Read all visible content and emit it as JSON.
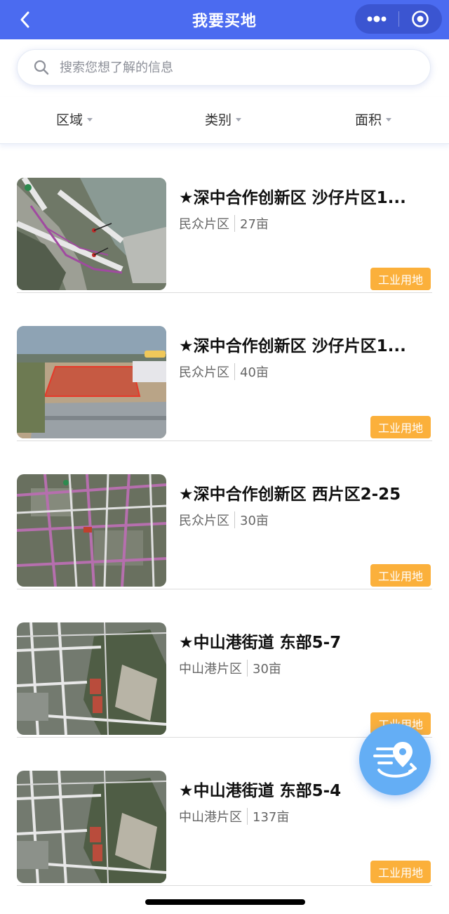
{
  "colors": {
    "accent": "#4b6bf0",
    "tag": "#fbb03b",
    "fab": "#64aef5"
  },
  "header": {
    "title": "我要买地",
    "back_icon": "chevron-left-icon",
    "more_icon": "more-dots-icon",
    "close_icon": "target-close-icon"
  },
  "search": {
    "placeholder": "搜索您想了解的信息",
    "value": "",
    "icon": "search-icon"
  },
  "filters": {
    "region": "区域",
    "type": "类别",
    "area": "面积"
  },
  "listings": [
    {
      "title": "★深中合作创新区 沙仔片区1...",
      "district": "民众片区",
      "size": "27亩",
      "tag": "工业用地"
    },
    {
      "title": "★深中合作创新区 沙仔片区1...",
      "district": "民众片区",
      "size": "40亩",
      "tag": "工业用地"
    },
    {
      "title": "★深中合作创新区 西片区2-25",
      "district": "民众片区",
      "size": "30亩",
      "tag": "工业用地"
    },
    {
      "title": "★中山港街道 东部5-7",
      "district": "中山港片区",
      "size": "30亩",
      "tag": "工业用地"
    },
    {
      "title": "★中山港街道 东部5-4",
      "district": "中山港片区",
      "size": "137亩",
      "tag": "工业用地"
    }
  ],
  "fab": {
    "icon": "map-location-icon"
  }
}
